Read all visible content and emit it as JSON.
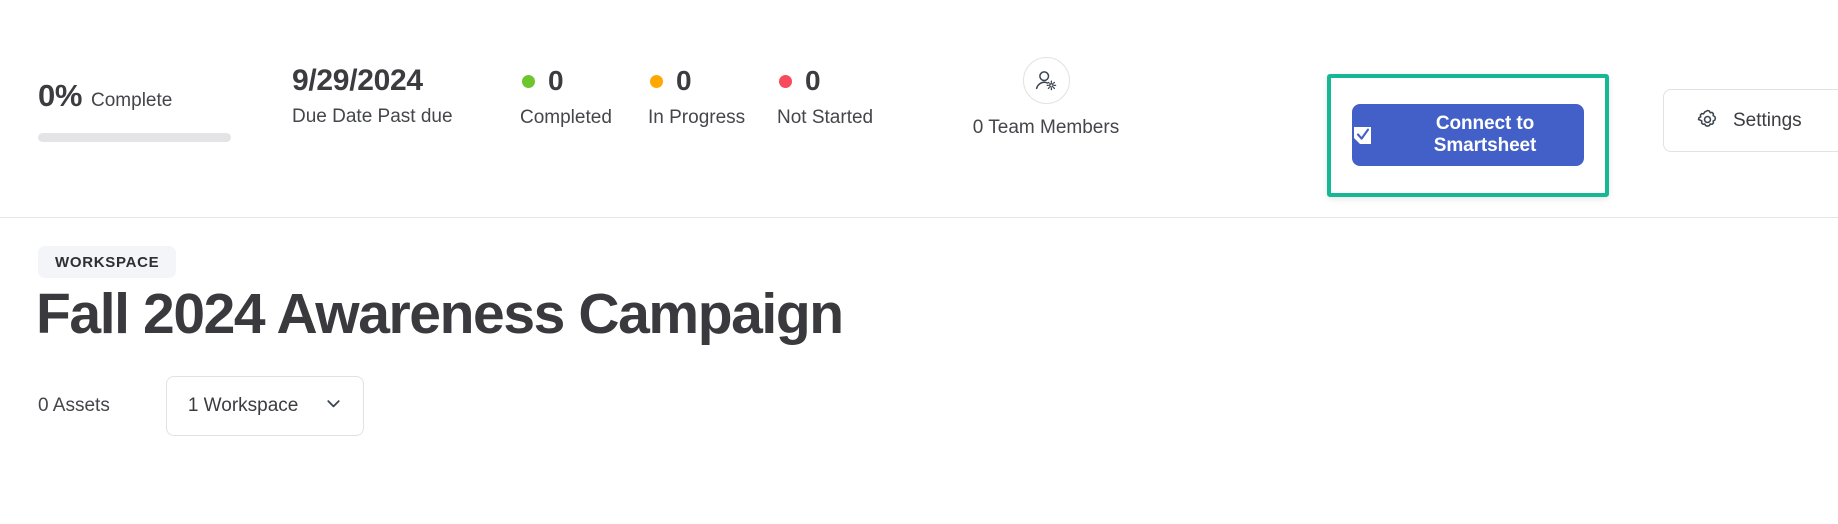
{
  "summary": {
    "progress": {
      "percent_label": "0%",
      "percent_value": 0,
      "label": "Complete"
    },
    "due": {
      "date": "9/29/2024",
      "sub": "Due Date Past due"
    },
    "statuses": [
      {
        "key": "completed",
        "count": "0",
        "label": "Completed",
        "color": "#6ec62f"
      },
      {
        "key": "in_progress",
        "count": "0",
        "label": "In Progress",
        "color": "#ffa800"
      },
      {
        "key": "not_started",
        "count": "0",
        "label": "Not Started",
        "color": "#f74a5c"
      }
    ],
    "team": {
      "label": "0 Team Members",
      "icon": "user-settings-icon"
    },
    "connect_button": {
      "label": "Connect to Smartsheet",
      "icon": "smartsheet-check-icon",
      "background": "#4360c8",
      "highlight_color": "#16b795"
    },
    "settings_button": {
      "label": "Settings",
      "icon": "gear-icon"
    }
  },
  "main": {
    "badge": "WORKSPACE",
    "title": "Fall 2024 Awareness Campaign",
    "assets_count": "0 Assets",
    "workspace_select": {
      "value": "1 Workspace",
      "icon": "chevron-down-icon"
    }
  }
}
